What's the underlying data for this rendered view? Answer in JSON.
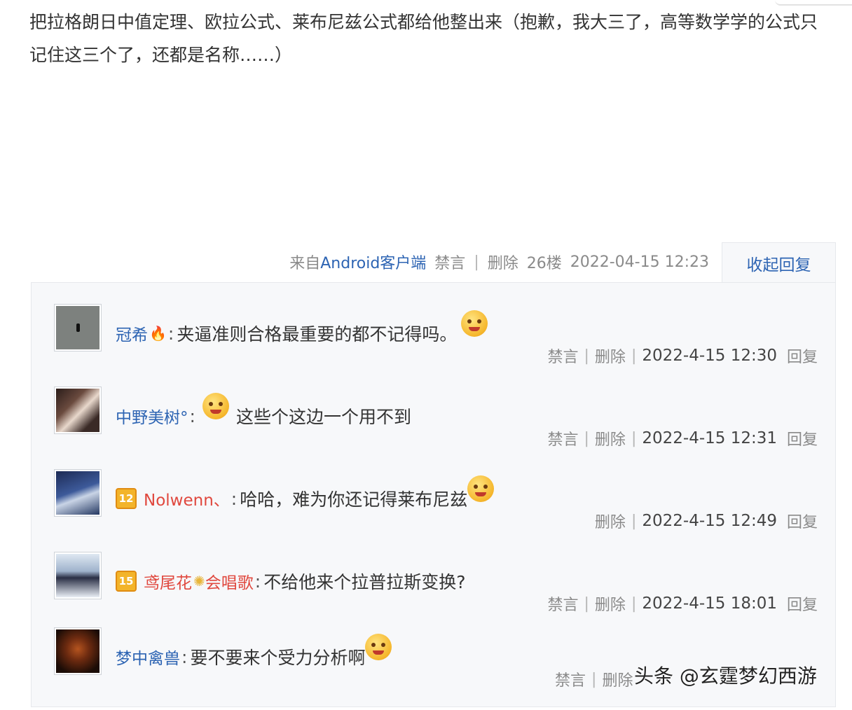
{
  "post": {
    "text": "把拉格朗日中值定理、欧拉公式、莱布尼兹公式都给他整出来（抱歉，我大三了，高等数学学的公式只记住这三个了，还都是名称……）",
    "meta": {
      "client_prefix": "来自",
      "client_name": "Android客户端",
      "ban": "禁言",
      "divider": "|",
      "delete": "删除",
      "floor": "26楼",
      "datetime": "2022-04-15 12:23"
    },
    "collapse_label": "收起回复"
  },
  "replies": [
    {
      "user": "冠希",
      "user_suffix": "🔥",
      "colon": ":",
      "content": "夹逼准则合格最重要的都不记得吗。",
      "emoji": "angry-face-icon",
      "ban": "禁言",
      "delete": "删除",
      "date": "2022-4-15 12:30",
      "reply": "回复"
    },
    {
      "user": "中野美树°",
      "colon": ":",
      "emoji": "sweat-face-icon",
      "content": "这些个这边一个用不到",
      "ban": "禁言",
      "delete": "删除",
      "date": "2022-4-15 12:31",
      "reply": "回复"
    },
    {
      "user": "Nolwenn、",
      "vip": "12",
      "colon": ":",
      "content": "哈哈，难为你还记得莱布尼兹",
      "emoji": "laughing-face-icon",
      "delete": "删除",
      "date": "2022-4-15 12:49",
      "reply": "回复"
    },
    {
      "user": "鸢尾花",
      "user_mid_icon": "✺",
      "user_tail": "会唱歌",
      "vip": "15",
      "colon": ":",
      "content": "不给他来个拉普拉斯变换?",
      "ban": "禁言",
      "delete": "删除",
      "date": "2022-4-15 18:01",
      "reply": "回复"
    },
    {
      "user": "梦中禽兽",
      "colon": ":",
      "content": "要不要来个受力分析啊",
      "emoji": "grimace-face-icon",
      "ban": "禁言",
      "delete": "删除"
    }
  ],
  "watermark": "头条 @玄霆梦幻西游",
  "colors": {
    "link": "#2d64b3",
    "vip_name": "#e0483e",
    "meta": "#8a8a8a",
    "panel_bg": "#f7f8fa"
  }
}
